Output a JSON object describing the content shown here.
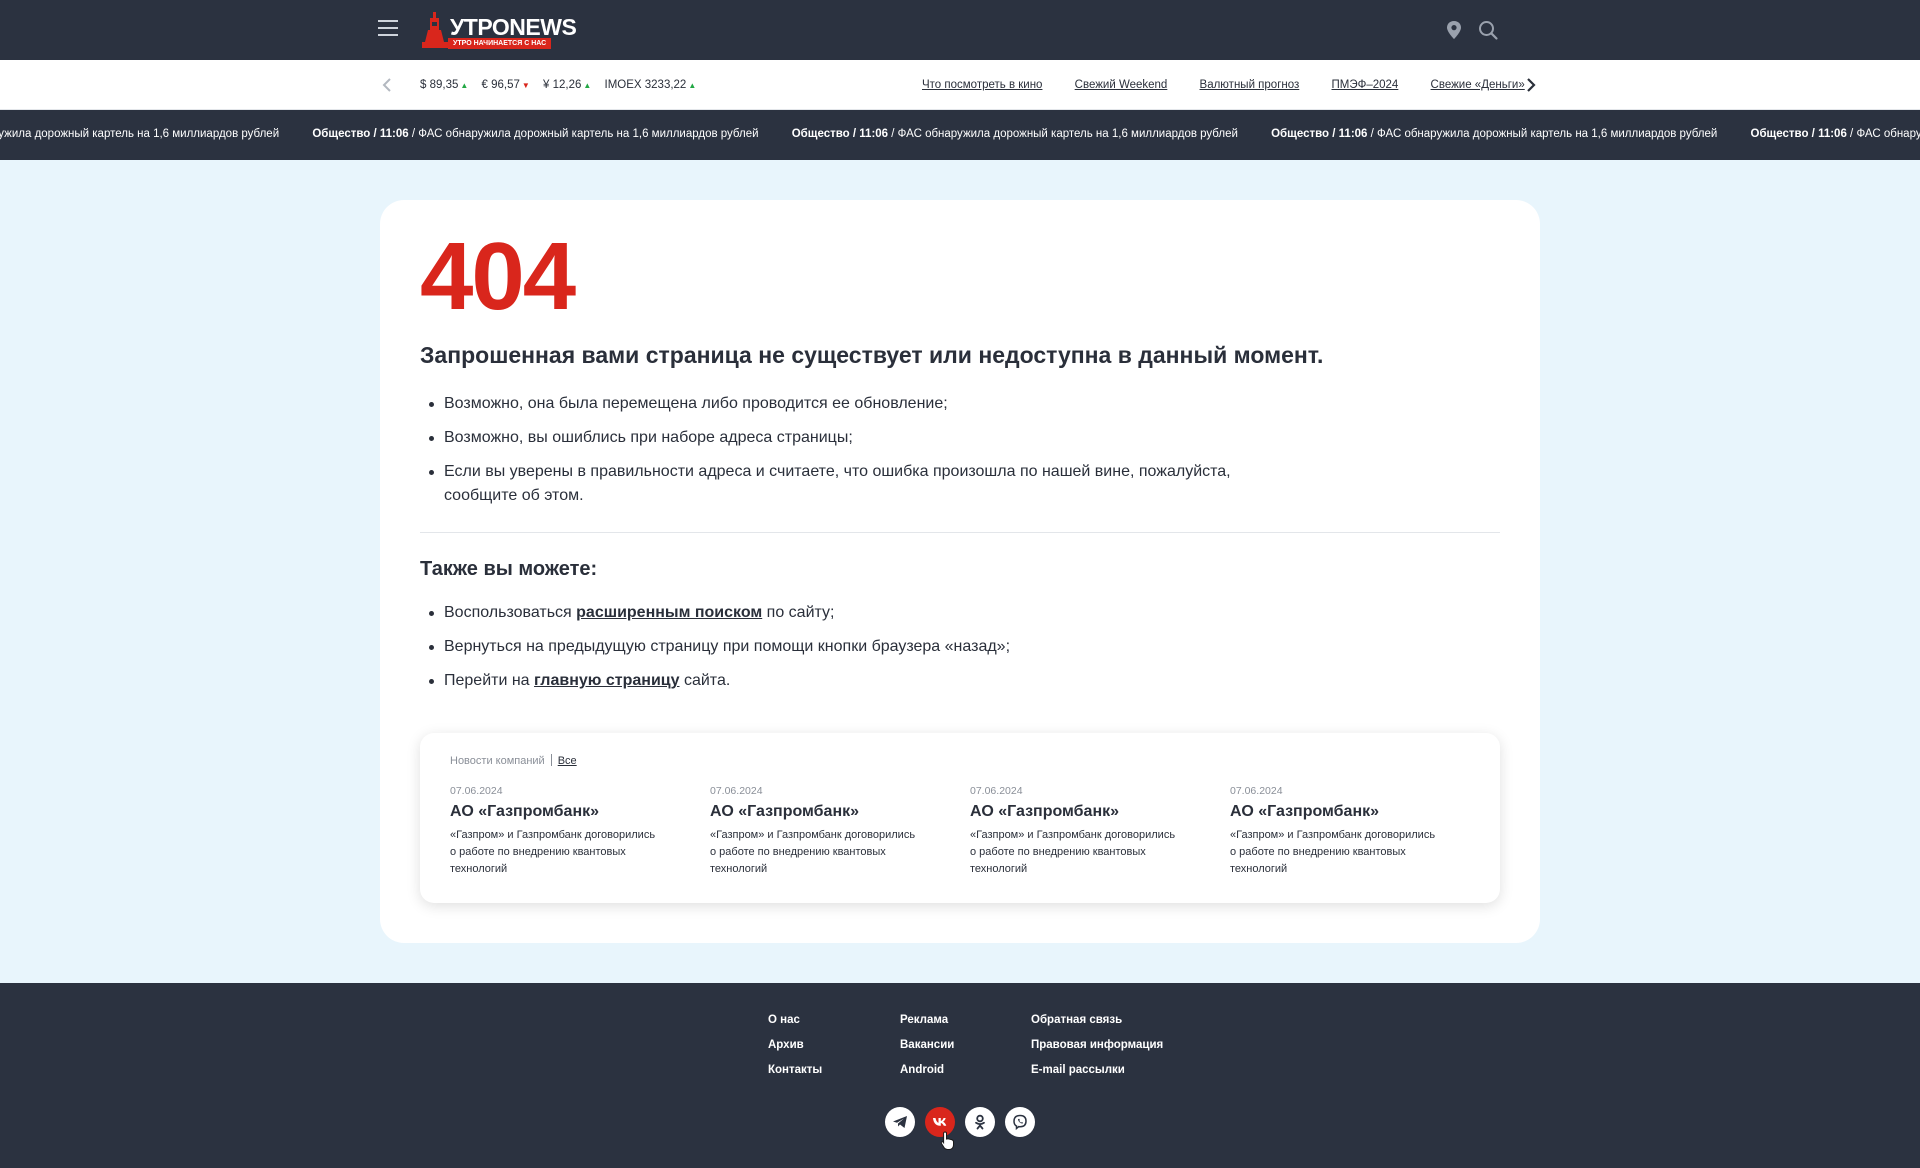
{
  "header": {
    "logo_title": "УТРОNEWS",
    "logo_subtitle": "УТРО НАЧИНАЕТСЯ С НАС",
    "icons": [
      "menu-icon",
      "location-icon",
      "search-icon"
    ]
  },
  "market": {
    "quotes": [
      {
        "label": "$ 89,35",
        "trend": "up"
      },
      {
        "label": "€ 96,57",
        "trend": "down"
      },
      {
        "label": "¥ 12,26",
        "trend": "up"
      },
      {
        "label": "IMOEX 3233,22",
        "trend": "up"
      }
    ],
    "links": [
      "Что посмотреть в кино",
      "Свежий Weekend",
      "Валютный прогноз",
      "ПМЭФ–2024",
      "Свежие «Деньги»"
    ]
  },
  "ticker": {
    "partial": "ружила дорожный картель на 1,6 миллиардов рублей",
    "category": "Общество",
    "time": "11:06",
    "headline": "ФАС обнаружила дорожный картель на 1,6 миллиардов рублей"
  },
  "error": {
    "code": "404",
    "title": "Запрошенная вами страница не существует или недоступна в данный момент.",
    "reasons": [
      "Возможно, она была перемещена либо проводится ее обновление;",
      "Возможно, вы ошиблись при наборе адреса страницы;",
      "Если вы уверены в правильности адреса и считаете, что ошибка произошла по нашей вине, пожалуйста, сообщите об этом."
    ],
    "also_title": "Также вы можете:",
    "also": [
      {
        "before": "Воспользоваться ",
        "link": "расширенным поиском",
        "after": " по сайту;"
      },
      {
        "before": "Вернуться на предыдущую страницу при помощи кнопки браузера «назад»;",
        "link": "",
        "after": ""
      },
      {
        "before": "Перейти на ",
        "link": "главную страницу",
        "after": " сайта."
      }
    ]
  },
  "company_news": {
    "heading": "Новости компаний",
    "all_link": "Все",
    "items": [
      {
        "date": "07.06.2024",
        "title": "АО «Газпромбанк»",
        "text": "«Газпром» и Газпромбанк договорились о работе по внедрению квантовых технологий"
      },
      {
        "date": "07.06.2024",
        "title": "АО «Газпромбанк»",
        "text": "«Газпром» и Газпромбанк договорились о работе по внедрению квантовых технологий"
      },
      {
        "date": "07.06.2024",
        "title": "АО «Газпромбанк»",
        "text": "«Газпром» и Газпромбанк договорились о работе по внедрению квантовых технологий"
      },
      {
        "date": "07.06.2024",
        "title": "АО «Газпромбанк»",
        "text": "«Газпром» и Газпромбанк договорились о работе по внедрению квантовых технологий"
      }
    ]
  },
  "footer": {
    "columns": [
      [
        "О нас",
        "Архив",
        "Контакты"
      ],
      [
        "Реклама",
        "Вакансии",
        "Android"
      ],
      [
        "Обратная связь",
        "Правовая информация",
        "E-mail рассылки"
      ]
    ],
    "social": [
      "telegram-icon",
      "vk-icon",
      "odnoklassniki-icon",
      "viber-icon"
    ]
  },
  "colors": {
    "accent": "#d9261c",
    "dark": "#2b3240",
    "page_bg": "#e8f5fc",
    "up": "#23a845"
  }
}
